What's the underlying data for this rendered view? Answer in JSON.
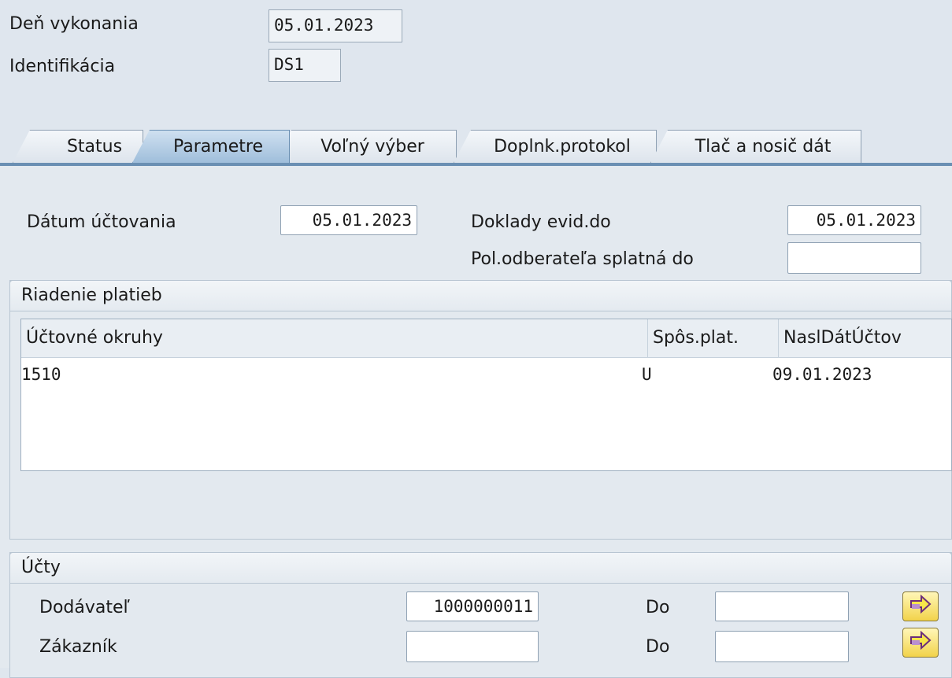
{
  "header": {
    "den_vykonania_label": "Deň vykonania",
    "den_vykonania_value": "05.01.2023",
    "identifikacia_label": "Identifikácia",
    "identifikacia_value": "DS1"
  },
  "tabs": [
    {
      "label": "Status"
    },
    {
      "label": "Parametre"
    },
    {
      "label": "Voľný výber"
    },
    {
      "label": "Doplnk.protokol"
    },
    {
      "label": "Tlač a nosič dát"
    }
  ],
  "params": {
    "datum_uctovania_label": "Dátum účtovania",
    "datum_uctovania_value": "05.01.2023",
    "doklady_label": "Doklady evid.do",
    "doklady_value": "05.01.2023",
    "pol_odberatela_label": "Pol.odberateľa splatná do",
    "pol_odberatela_value": ""
  },
  "riadenie": {
    "title": "Riadenie platieb",
    "columns": [
      "Účtovné okruhy",
      "Spôs.plat.",
      "NaslDátÚčtov"
    ],
    "rows": [
      {
        "okruh": "1510",
        "sposob": "U",
        "datum": "09.01.2023"
      }
    ]
  },
  "ucty": {
    "title": "Účty",
    "dodavatel_label": "Dodávateľ",
    "dodavatel_value": "1000000011",
    "dodavatel_do_label": "Do",
    "dodavatel_do_value": "",
    "zakaznik_label": "Zákazník",
    "zakaznik_value": "",
    "zakaznik_do_label": "Do",
    "zakaznik_do_value": ""
  },
  "icons": {
    "multiple_selection": "arrow-right-icon"
  },
  "colors": {
    "active_tab": "#9fbedb",
    "button": "#f2d34a",
    "tab_line": "#6a8fb3"
  }
}
